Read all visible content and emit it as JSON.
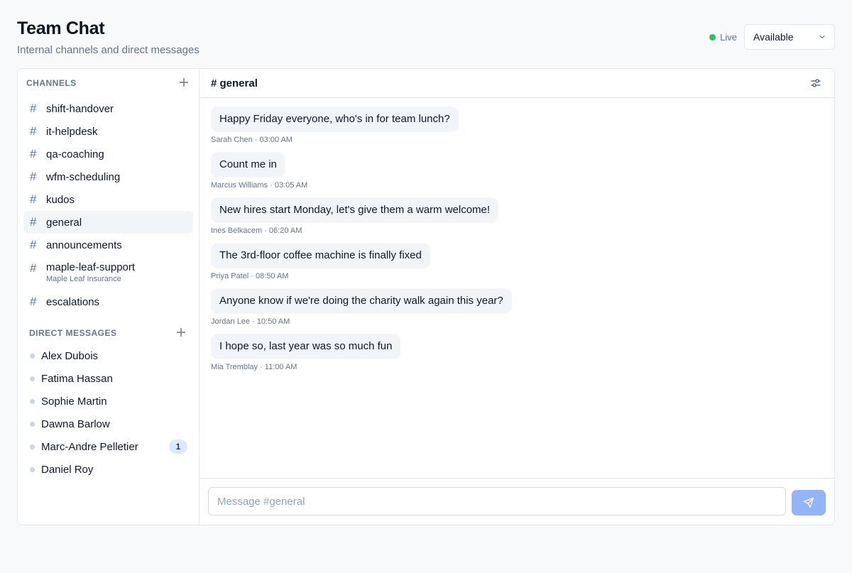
{
  "header": {
    "title": "Team Chat",
    "subtitle": "Internal channels and direct messages",
    "live_label": "Live",
    "status_value": "Available"
  },
  "sidebar": {
    "channels_label": "CHANNELS",
    "channels": [
      {
        "name": "shift-handover"
      },
      {
        "name": "it-helpdesk"
      },
      {
        "name": "qa-coaching"
      },
      {
        "name": "wfm-scheduling"
      },
      {
        "name": "kudos"
      },
      {
        "name": "general",
        "active": true
      },
      {
        "name": "announcements"
      },
      {
        "name": "maple-leaf-support",
        "subtitle": "Maple Leaf Insurance"
      },
      {
        "name": "escalations"
      }
    ],
    "dm_label": "DIRECT MESSAGES",
    "dms": [
      {
        "name": "Alex Dubois"
      },
      {
        "name": "Fatima Hassan"
      },
      {
        "name": "Sophie Martin"
      },
      {
        "name": "Dawna Barlow"
      },
      {
        "name": "Marc-Andre Pelletier",
        "unread": "1"
      },
      {
        "name": "Daniel Roy"
      }
    ],
    "hash_symbol": "#"
  },
  "chat": {
    "title": "# general",
    "messages": [
      {
        "text": "Happy Friday everyone, who's in for team lunch?",
        "meta": "Sarah Chen · 03:00 AM"
      },
      {
        "text": "Count me in",
        "meta": "Marcus Williams · 03:05 AM"
      },
      {
        "text": "New hires start Monday, let's give them a warm welcome!",
        "meta": "Ines Belkacem · 06:20 AM"
      },
      {
        "text": "The 3rd-floor coffee machine is finally fixed",
        "meta": "Priya Patel · 08:50 AM"
      },
      {
        "text": "Anyone know if we're doing the charity walk again this year?",
        "meta": "Jordan Lee · 10:50 AM"
      },
      {
        "text": "I hope so, last year was so much fun",
        "meta": "Mia Tremblay · 11:00 AM"
      }
    ],
    "input_placeholder": "Message #general"
  },
  "icons": {
    "live": "status-dot-icon",
    "status_select": "chevron-down-icon",
    "add": "plus-icon",
    "filter": "sliders-icon",
    "send": "send-icon"
  },
  "colors": {
    "live": "#22c55e",
    "send_button": "#93b4f8",
    "badge_bg": "#dbeafe",
    "active_channel_bg": "#f1f5f9"
  }
}
